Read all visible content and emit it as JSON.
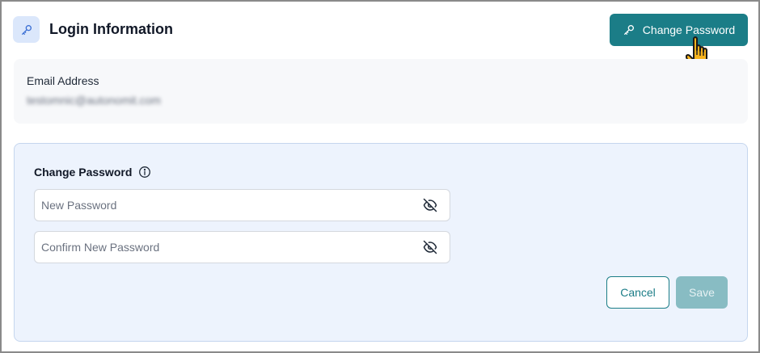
{
  "header": {
    "title": "Login Information",
    "icon": "key-icon",
    "change_password_button": {
      "label": "Change Password",
      "icon": "key-icon"
    }
  },
  "email": {
    "label": "Email Address",
    "value": "testomnic@autonomit.com"
  },
  "change_password": {
    "title": "Change Password",
    "info_icon": "info-icon",
    "new_password": {
      "placeholder": "New Password",
      "value": "",
      "icon": "eye-off-icon"
    },
    "confirm_password": {
      "placeholder": "Confirm New Password",
      "value": "",
      "icon": "eye-off-icon"
    },
    "cancel_label": "Cancel",
    "save_label": "Save"
  },
  "colors": {
    "accent": "#1b7d87",
    "accent_disabled": "#88bcc3",
    "panel_bg": "#edf3fd",
    "icon_bg": "#dbe7fb"
  }
}
